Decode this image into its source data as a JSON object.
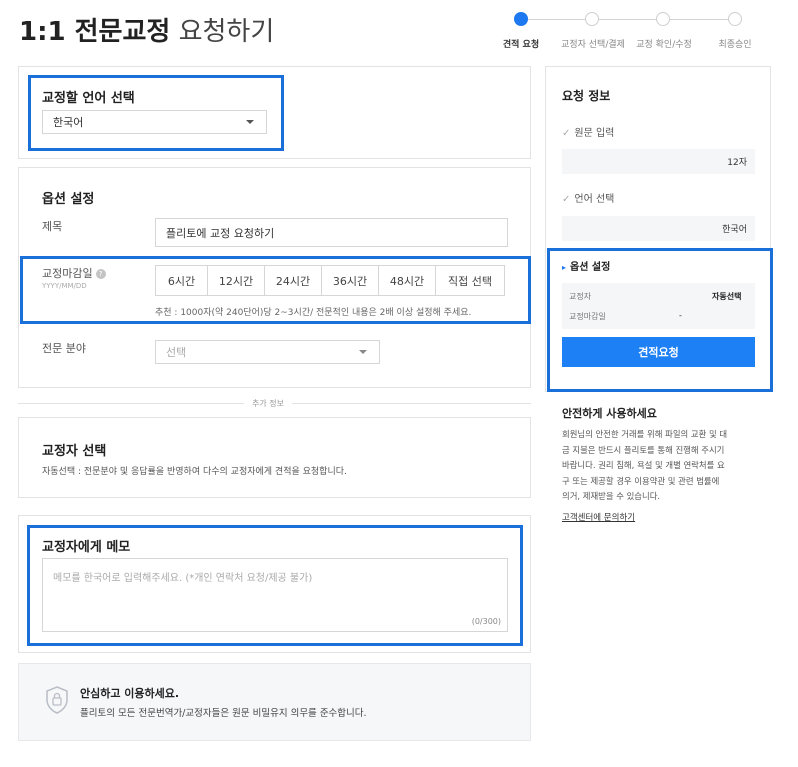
{
  "page": {
    "title_strong": "1:1 전문교정",
    "title_light": "요청하기"
  },
  "steps": [
    {
      "label": "견적 요청",
      "active": true
    },
    {
      "label": "교정자 선택/결제",
      "active": false
    },
    {
      "label": "교정 확인/수정",
      "active": false
    },
    {
      "label": "최종승인",
      "active": false
    }
  ],
  "language": {
    "title": "교정할 언어 선택",
    "selected": "한국어"
  },
  "options": {
    "title": "옵션 설정",
    "subject_label": "제목",
    "subject_value": "플리토에 교정 요청하기",
    "deadline_label": "교정마감일",
    "deadline_help": "?",
    "deadline_format": "YYYY/MM/DD",
    "time_buttons": [
      "6시간",
      "12시간",
      "24시간",
      "36시간",
      "48시간",
      "직접 선택"
    ],
    "deadline_hint": "추천 : 1000자(약 240단어)당 2~3시간/ 전문적인 내용은 2배 이상 설정해 주세요.",
    "field_label": "전문 분야",
    "field_placeholder": "선택"
  },
  "divider": {
    "label": "추가 정보"
  },
  "proofreader": {
    "title": "교정자 선택",
    "desc": "자동선택 : 전문분야 및 응답률을 반영하여 다수의 교정자에게 견적을 요청합니다."
  },
  "memo": {
    "title": "교정자에게 메모",
    "placeholder": "메모를 한국어로 입력해주세요. (*개인 연락처 요청/제공 불가)",
    "counter": "(0/300)"
  },
  "notice": {
    "title": "안심하고 이용하세요.",
    "body": "플리토의 모든 전문번역가/교정자들은 원문 비밀유지 의무를 준수합니다."
  },
  "sidebar": {
    "title": "요청 정보",
    "source_label": "원문 입력",
    "source_value": "12자",
    "language_label": "언어 선택",
    "language_value": "한국어",
    "option_label": "옵션 설정",
    "proofreader_label": "교정자",
    "proofreader_value": "자동선택",
    "deadline_label": "교정마감일",
    "deadline_value": "-",
    "button_label": "견적요청",
    "check_mark": "✓",
    "arrow_mark": "▸"
  },
  "safe": {
    "title": "안전하게 사용하세요",
    "lines": [
      "회원님의 안전한 거래를 위해 파일의 교환 및 대",
      "금 지불은 반드시 플리토를 통해 진행해 주시기",
      "바랍니다. 권리 침해, 욕설 및 개별 연락처를 요",
      "구 또는 제공할 경우 이용약관 및 관련 법률에",
      "의거, 제재받을 수 있습니다."
    ],
    "link": "고객센터에 문의하기"
  },
  "colors": {
    "accent": "#1e80f5",
    "highlight": "#1b6fd8",
    "step_active": "#1e78f0"
  }
}
